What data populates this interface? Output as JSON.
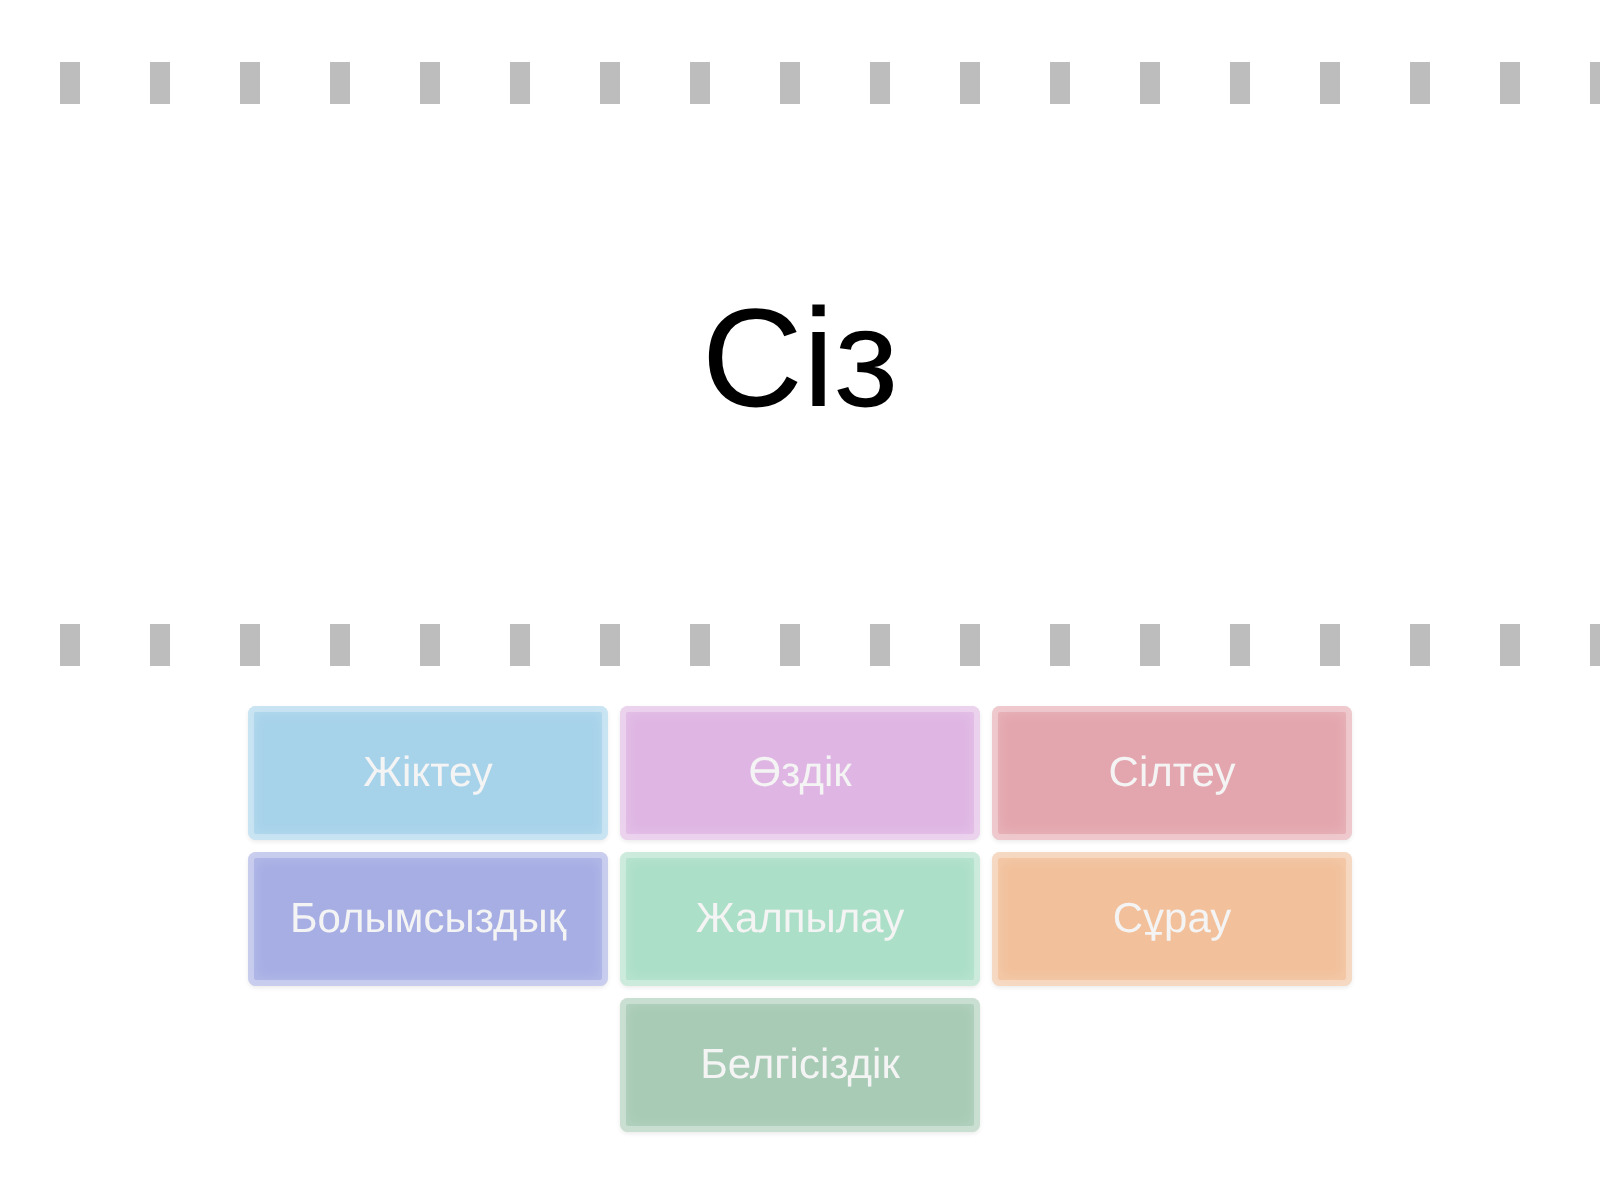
{
  "prompt": {
    "text": "Сіз"
  },
  "tiles": [
    {
      "label": "Жіктеу",
      "color": "#a6d2ea"
    },
    {
      "label": "Өздік",
      "color": "#dfb6e3"
    },
    {
      "label": "Сілтеу",
      "color": "#e4a6ae"
    },
    {
      "label": "Болымсыздық",
      "color": "#a6aee4"
    },
    {
      "label": "Жалпылау",
      "color": "#acdfc8"
    },
    {
      "label": "Сұрау",
      "color": "#f2c19c"
    },
    {
      "label": "Белгісіздік",
      "color": "#a7cbb5"
    }
  ]
}
